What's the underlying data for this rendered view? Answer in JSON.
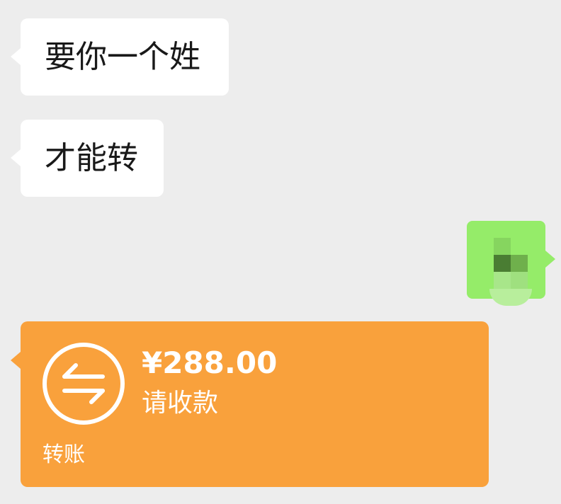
{
  "messages": [
    {
      "sender": "other",
      "text": "要你一个姓"
    },
    {
      "sender": "other",
      "text": "才能转"
    },
    {
      "sender": "self",
      "type": "sticker",
      "sticker": "pixelated-sticker"
    }
  ],
  "transfer": {
    "amount": "¥288.00",
    "status": "请收款",
    "label": "转账",
    "icon": "transfer-arrows-icon",
    "color": "#f9a13c"
  },
  "colors": {
    "background": "#ededed",
    "incoming_bubble": "#ffffff",
    "outgoing_bubble": "#95ec69"
  }
}
